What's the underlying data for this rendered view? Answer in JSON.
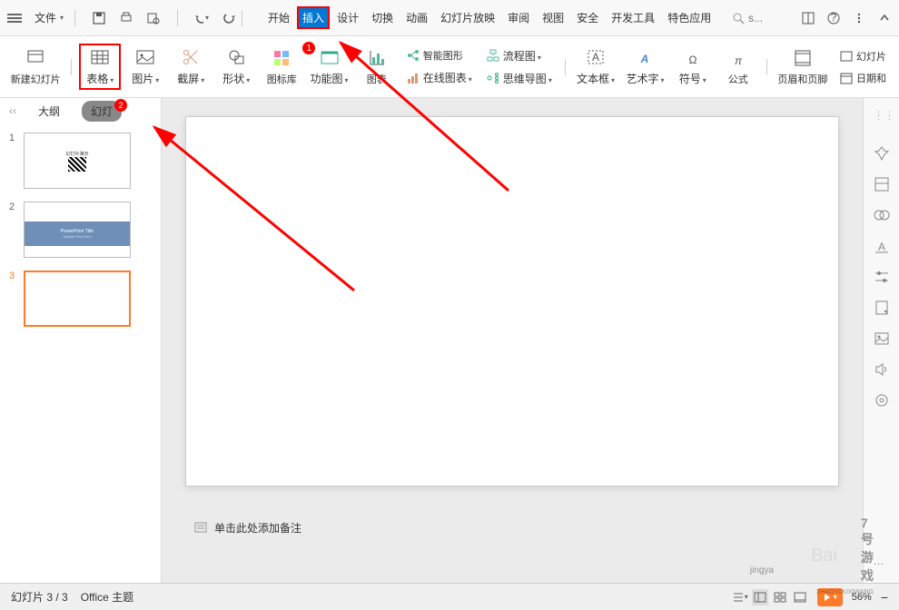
{
  "menubar": {
    "file": "文件",
    "tabs": {
      "start": "开始",
      "insert": "插入",
      "design": "设计",
      "transition": "切换",
      "animation": "动画",
      "slideshow": "幻灯片放映",
      "review": "审阅",
      "view": "视图",
      "security": "安全",
      "devtools": "开发工具",
      "featured": "特色应用"
    },
    "search_placeholder": "s..."
  },
  "ribbon": {
    "new_slide": "新建幻灯片",
    "table": "表格",
    "picture": "图片",
    "screenshot": "截屏",
    "shapes": "形状",
    "icons": "图标库",
    "funcimg": "功能图",
    "chart": "图表",
    "smartart": "智能图形",
    "online_chart": "在线图表",
    "flowchart": "流程图",
    "mindmap": "思维导图",
    "textbox": "文本框",
    "wordart": "艺术字",
    "symbol": "符号",
    "equation": "公式",
    "header_footer": "页眉和页脚",
    "slide": "幻灯片",
    "datetime": "日期和"
  },
  "panel": {
    "outline": "大纲",
    "slides": "幻灯",
    "badge": "2"
  },
  "thumbs": {
    "t2_title": "PowerPoint Title",
    "t2_sub": "Subtitle Text Here"
  },
  "notes": "单击此处添加备注",
  "status": {
    "slide_info": "幻灯片 3 / 3",
    "theme": "Office 主题",
    "zoom": "56%"
  },
  "watermark": {
    "brand1": "jingya",
    "brand2": "7号游戏",
    "brand3": "ZHAOYOUXIWANG"
  },
  "badges": {
    "funcimg": "1"
  },
  "colors": {
    "accent": "#ff7b29",
    "highlight": "#ff0000",
    "blue": "#0078d4"
  }
}
